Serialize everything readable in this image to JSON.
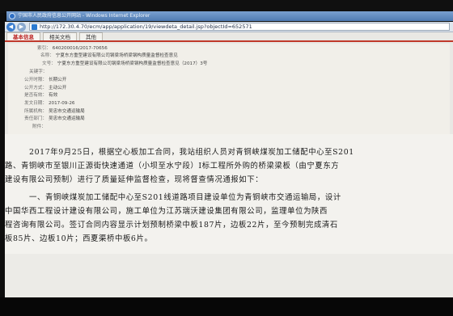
{
  "window": {
    "title": "宁国市人民政府信息公开网站 - Windows Internet Explorer"
  },
  "address_bar": {
    "url": "http://172.30.4.70/ecm/app/application/19/viewdeta_detail.jsp?objectId=652571"
  },
  "tabs": [
    {
      "label": "基本信息"
    },
    {
      "label": "相关文档"
    },
    {
      "label": "其他"
    }
  ],
  "meta": [
    {
      "key": "索引：",
      "value": "640200016/2017-70656"
    },
    {
      "key": "名称：",
      "value": "宁夏东方重型建设有限公司钢梁场桥梁钢构质量监督检查意见"
    },
    {
      "key": "文号：",
      "value": "宁夏东方重型建设有限公司钢梁场桥梁钢构质量监督检查意见（2017）3号"
    },
    {
      "key": "关键字：",
      "value": ""
    },
    {
      "key": "公开时限：",
      "value": "长期公开"
    },
    {
      "key": "公开方式：",
      "value": "主动公开"
    },
    {
      "key": "是否有效：",
      "value": "有效"
    },
    {
      "key": "发文日期：",
      "value": "2017-09-26"
    },
    {
      "key": "所属机构：",
      "value": "吴忠市交通运输局"
    },
    {
      "key": "责任部门：",
      "value": "吴忠市交通运输局"
    },
    {
      "key": "附件：",
      "value": ""
    }
  ],
  "document": {
    "paragraphs": [
      "2017年9月25日，根据空心板加工合同，我站组织人员对青铜峡煤炭加工储配中心至S201",
      "路、青铜峡市至银川正源街快速通道（小坝至水宁段）I标工程所外购的桥梁梁板（由宁夏东方",
      "建设有限公司预制）进行了质量延伸监督检查，现将督查情况通报如下：",
      "一、青铜峡煤炭加工储配中心至S201线道路项目建设单位为青铜峡市交通运输局，设计",
      "中国华西工程设计建设有限公司，施工单位为江苏瑞沃建设集团有限公司，监理单位为陕西",
      "程咨询有限公司。签订合同内容显示计划预制桥梁中板187片，边板22片，至今预制完成清石",
      "板85片、边板10片；西夏渠桥中板6片。"
    ],
    "scroll_marker": "‹"
  }
}
